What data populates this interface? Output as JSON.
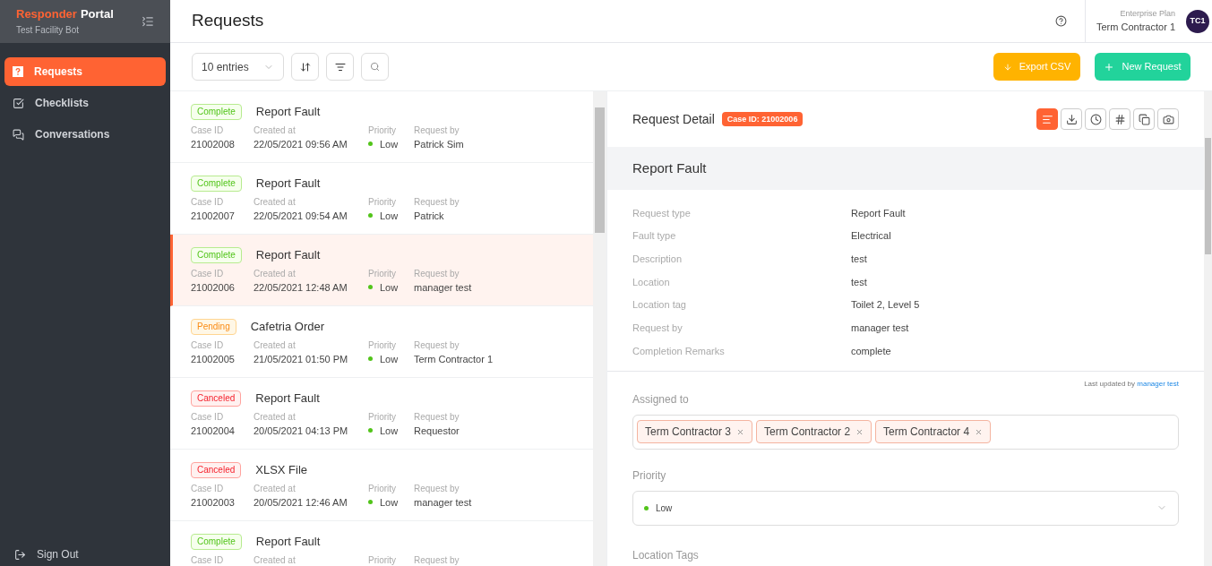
{
  "sidebar": {
    "brand_primary": "Responder",
    "brand_secondary": "Portal",
    "subtitle": "Test Facility Bot",
    "items": [
      {
        "label": "Requests",
        "selected": true,
        "kind": "requests"
      },
      {
        "label": "Checklists",
        "selected": false,
        "kind": "checklists"
      },
      {
        "label": "Conversations",
        "selected": false,
        "kind": "conversations"
      }
    ],
    "sign_out": "Sign Out"
  },
  "header": {
    "title": "Requests",
    "plan": "Enterprise Plan",
    "user": "Term Contractor 1",
    "avatar": "TC1"
  },
  "toolbar": {
    "entries": "10 entries",
    "export": "Export CSV",
    "new_request": "New Request"
  },
  "list": {
    "rows": [
      {
        "status": "Complete",
        "kind": "complete",
        "title": "Report Fault",
        "labels": [
          "Case ID",
          "Created at",
          "Priority",
          "Request by"
        ],
        "case_id": "21002008",
        "created_at": "22/05/2021 09:56 AM",
        "priority": "Low",
        "request_by": "Patrick Sim",
        "selected": false
      },
      {
        "status": "Complete",
        "kind": "complete",
        "title": "Report Fault",
        "labels": [
          "Case ID",
          "Created at",
          "Priority",
          "Request by"
        ],
        "case_id": "21002007",
        "created_at": "22/05/2021 09:54 AM",
        "priority": "Low",
        "request_by": "Patrick",
        "selected": false
      },
      {
        "status": "Complete",
        "kind": "complete",
        "title": "Report Fault",
        "labels": [
          "Case ID",
          "Created at",
          "Priority",
          "Request by"
        ],
        "case_id": "21002006",
        "created_at": "22/05/2021 12:48 AM",
        "priority": "Low",
        "request_by": "manager test",
        "selected": true
      },
      {
        "status": "Pending",
        "kind": "pending",
        "title": "Cafetria Order",
        "labels": [
          "Case ID",
          "Created at",
          "Priority",
          "Request by"
        ],
        "case_id": "21002005",
        "created_at": "21/05/2021 01:50 PM",
        "priority": "Low",
        "request_by": "Term Contractor 1",
        "selected": false
      },
      {
        "status": "Canceled",
        "kind": "canceled",
        "title": "Report Fault",
        "labels": [
          "Case ID",
          "Created at",
          "Priority",
          "Request by"
        ],
        "case_id": "21002004",
        "created_at": "20/05/2021 04:13 PM",
        "priority": "Low",
        "request_by": "Requestor",
        "selected": false
      },
      {
        "status": "Canceled",
        "kind": "canceled",
        "title": "XLSX File",
        "labels": [
          "Case ID",
          "Created at",
          "Priority",
          "Request by"
        ],
        "case_id": "21002003",
        "created_at": "20/05/2021 12:46 AM",
        "priority": "Low",
        "request_by": "manager test",
        "selected": false
      },
      {
        "status": "Complete",
        "kind": "complete",
        "title": "Report Fault",
        "labels": [
          "Case ID",
          "Created at",
          "Priority",
          "Request by"
        ],
        "selected": false
      }
    ]
  },
  "detail": {
    "title": "Request Detail",
    "case_badge": "Case ID: 21002006",
    "tabs": [
      {
        "kind": "text",
        "selected": true
      },
      {
        "kind": "download",
        "selected": false
      },
      {
        "kind": "clock",
        "selected": false
      },
      {
        "kind": "hash",
        "selected": false
      },
      {
        "kind": "copy",
        "selected": false
      },
      {
        "kind": "camera",
        "selected": false
      }
    ],
    "heading": "Report Fault",
    "fields": [
      {
        "label": "Request type",
        "value": "Report Fault"
      },
      {
        "label": "Fault type",
        "value": "Electrical"
      },
      {
        "label": "Description",
        "value": "test"
      },
      {
        "label": "Location",
        "value": "test"
      },
      {
        "label": "Location tag",
        "value": "Toilet 2, Level 5"
      },
      {
        "label": "Request by",
        "value": "manager test"
      },
      {
        "label": "Completion Remarks",
        "value": "complete"
      }
    ],
    "last_updated": "Last updated by",
    "last_updated_by": "manager test",
    "assigned_label": "Assigned to",
    "assigned": [
      "Term Contractor 3",
      "Term Contractor 2",
      "Term Contractor 4"
    ],
    "priority_label": "Priority",
    "priority": "Low",
    "location_tags_label": "Location Tags"
  }
}
